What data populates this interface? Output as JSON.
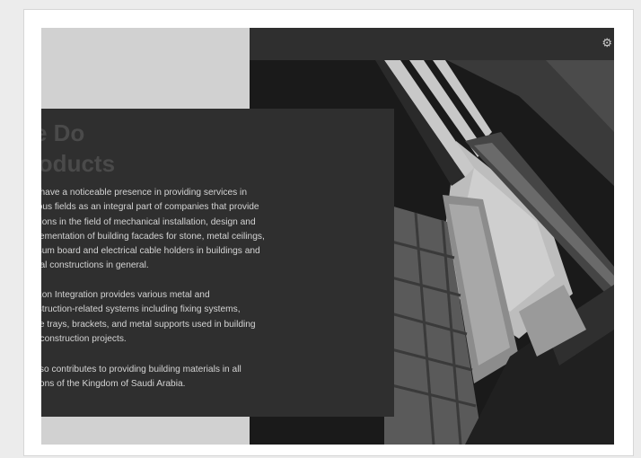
{
  "section": {
    "heading_line1": "t We Do",
    "heading_line2": "r Products",
    "paragraph1": "e have a noticeable presence in providing services in\nrious fields as an integral part of companies that provide\nutions in the field of mechanical installation, design and\nplementation of building facades for stone, metal ceilings,\npsum board and electrical cable holders in buildings and\netal constructions in general.",
    "paragraph2": "rizon Integration provides various metal and\nnstruction-related systems including fixing systems,\nble trays, brackets, and metal supports used in building\nd construction projects.",
    "paragraph3": "also contributes to providing building materials in all\ngions of the Kingdom of Saudi Arabia."
  },
  "topbar": {
    "icon": "gear-icon",
    "icon_glyph": "⚙"
  },
  "colors": {
    "page_bg": "#ececec",
    "panel_light": "#d1d1d1",
    "panel_dark": "#2f2f2f",
    "heading_text": "#4a4a4a",
    "body_text": "#d4d4d4"
  }
}
